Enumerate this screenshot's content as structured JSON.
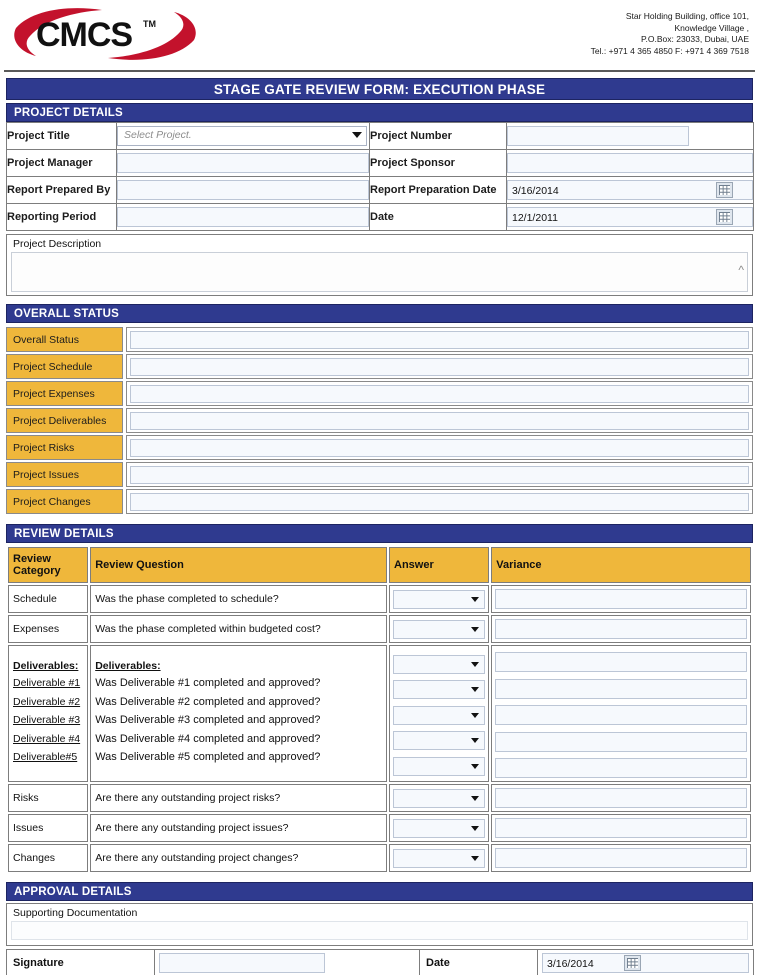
{
  "letterhead": {
    "logo_text": "CMCS",
    "logo_tm": "TM",
    "address_lines": [
      "Star Holding Building, office 101,",
      "Knowledge Village ,",
      "P.O.Box: 23033, Dubai, UAE",
      "Tel.: +971 4 365 4850 F: +971 4 369 7518"
    ]
  },
  "colors": {
    "band_blue": "#2f3a8f",
    "label_gold": "#efb73b",
    "logo_red": "#c3122c"
  },
  "form_title": "STAGE GATE REVIEW FORM: EXECUTION PHASE",
  "sections": {
    "project_details": "PROJECT DETAILS",
    "overall_status": "OVERALL STATUS",
    "review_details": "REVIEW DETAILS",
    "approval_details": "APPROVAL DETAILS"
  },
  "project_details": {
    "project_title_label": "Project Title",
    "project_title_placeholder": "Select Project.",
    "project_title_value": "",
    "project_number_label": "Project Number",
    "project_number_value": "",
    "project_manager_label": "Project Manager",
    "project_manager_value": "",
    "project_sponsor_label": "Project Sponsor",
    "project_sponsor_value": "",
    "report_prepared_by_label": "Report Prepared By",
    "report_prepared_by_value": "",
    "report_preparation_date_label": "Report Preparation Date",
    "report_preparation_date_value": "3/16/2014",
    "reporting_period_label": "Reporting Period",
    "reporting_period_value": "",
    "date_label": "Date",
    "date_value": "12/1/2011",
    "project_description_label": "Project Description",
    "project_description_value": ""
  },
  "overall_status_rows": [
    {
      "label": "Overall Status",
      "value": ""
    },
    {
      "label": "Project Schedule",
      "value": ""
    },
    {
      "label": "Project Expenses",
      "value": ""
    },
    {
      "label": "Project Deliverables",
      "value": ""
    },
    {
      "label": "Project Risks",
      "value": ""
    },
    {
      "label": "Project Issues",
      "value": ""
    },
    {
      "label": "Project Changes",
      "value": ""
    }
  ],
  "review_details": {
    "headers": {
      "category": "Review Category",
      "category_line1": "Review",
      "category_line2": "Category",
      "question": "Review Question",
      "answer": "Answer",
      "variance": "Variance"
    },
    "rows": [
      {
        "category": "Schedule",
        "question": "Was the phase completed to schedule?",
        "answer": "",
        "variance": ""
      },
      {
        "category": "Expenses",
        "question": "Was the phase completed within budgeted cost?",
        "answer": "",
        "variance": ""
      }
    ],
    "deliverables": {
      "category_heading": "Deliverables:",
      "question_heading": "Deliverables:",
      "items": [
        {
          "link": "Deliverable #1",
          "question": "Was Deliverable #1 completed and approved?",
          "answer": "",
          "variance": ""
        },
        {
          "link": "Deliverable #2",
          "question": "Was Deliverable #2 completed and approved?",
          "answer": "",
          "variance": ""
        },
        {
          "link": "Deliverable #3",
          "question": "Was Deliverable #3 completed and approved?",
          "answer": "",
          "variance": ""
        },
        {
          "link": "Deliverable #4",
          "question": "Was Deliverable #4 completed and approved?",
          "answer": "",
          "variance": ""
        },
        {
          "link": "Deliverable#5",
          "question": "Was Deliverable #5 completed and approved?",
          "answer": "",
          "variance": ""
        }
      ]
    },
    "trailing_rows": [
      {
        "category": "Risks",
        "question": "Are there any outstanding project risks?",
        "answer": "",
        "variance": ""
      },
      {
        "category": "Issues",
        "question": "Are there any outstanding project issues?",
        "answer": "",
        "variance": ""
      },
      {
        "category": "Changes",
        "question": "Are there any outstanding project changes?",
        "answer": "",
        "variance": ""
      }
    ]
  },
  "approval_details": {
    "supporting_documentation_label": "Supporting Documentation",
    "supporting_documentation_value": "",
    "signature_label": "Signature",
    "signature_value": "",
    "date_label": "Date",
    "date_value": "3/16/2014"
  }
}
